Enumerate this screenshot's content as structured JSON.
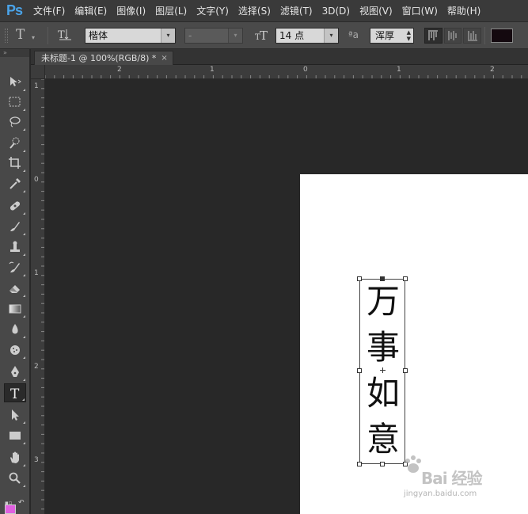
{
  "app": {
    "logo": "Ps"
  },
  "menu": [
    "文件(F)",
    "编辑(E)",
    "图像(I)",
    "图层(L)",
    "文字(Y)",
    "选择(S)",
    "滤镜(T)",
    "3D(D)",
    "视图(V)",
    "窗口(W)",
    "帮助(H)"
  ],
  "options": {
    "tool_icon": "T",
    "orientation_icon": "IT",
    "font_family": "楷体",
    "font_style": "-",
    "size_icon": "tT",
    "font_size": "14 点",
    "aa_icon": "ªa",
    "antialias": "浑厚",
    "text_color": "#14090f",
    "caret": "▾"
  },
  "document": {
    "tab_title": "未标题-1 @ 100%(RGB/8) *",
    "close": "×"
  },
  "ruler": {
    "h_labels": [
      "2",
      "1",
      "0",
      "1",
      "2"
    ],
    "v_labels": [
      "1",
      "0",
      "1",
      "2",
      "3"
    ]
  },
  "canvas": {
    "characters": [
      "万",
      "事",
      "如",
      "意"
    ]
  },
  "toolbar": {
    "header": "»",
    "tools": [
      {
        "name": "move-tool",
        "icon": "move-icon",
        "active": false
      },
      {
        "name": "marquee-tool",
        "icon": "rect-marquee-icon",
        "active": false
      },
      {
        "name": "lasso-tool",
        "icon": "lasso-icon",
        "active": false
      },
      {
        "name": "quick-select-tool",
        "icon": "quick-select-icon",
        "active": false
      },
      {
        "name": "crop-tool",
        "icon": "crop-icon",
        "active": false
      },
      {
        "name": "eyedropper-tool",
        "icon": "eyedropper-icon",
        "active": false
      },
      {
        "name": "healing-tool",
        "icon": "bandage-icon",
        "active": false
      },
      {
        "name": "brush-tool",
        "icon": "brush-icon",
        "active": false
      },
      {
        "name": "stamp-tool",
        "icon": "stamp-icon",
        "active": false
      },
      {
        "name": "history-brush-tool",
        "icon": "history-brush-icon",
        "active": false
      },
      {
        "name": "eraser-tool",
        "icon": "eraser-icon",
        "active": false
      },
      {
        "name": "gradient-tool",
        "icon": "gradient-icon",
        "active": false
      },
      {
        "name": "blur-tool",
        "icon": "blur-icon",
        "active": false
      },
      {
        "name": "dodge-tool",
        "icon": "sponge-icon",
        "active": false
      },
      {
        "name": "pen-tool",
        "icon": "pen-icon",
        "active": false
      },
      {
        "name": "type-tool",
        "icon": "type-icon",
        "active": true
      },
      {
        "name": "path-select-tool",
        "icon": "arrow-icon",
        "active": false
      },
      {
        "name": "shape-tool",
        "icon": "rectangle-icon",
        "active": false
      },
      {
        "name": "hand-tool",
        "icon": "hand-icon",
        "active": false
      },
      {
        "name": "zoom-tool",
        "icon": "magnifier-icon",
        "active": false
      }
    ],
    "type_glyph": "T",
    "foreground_color": "#e060e0",
    "swap_glyph": "↶"
  },
  "watermark": {
    "main": "Bai 经验",
    "sub": "jingyan.baidu.com"
  }
}
